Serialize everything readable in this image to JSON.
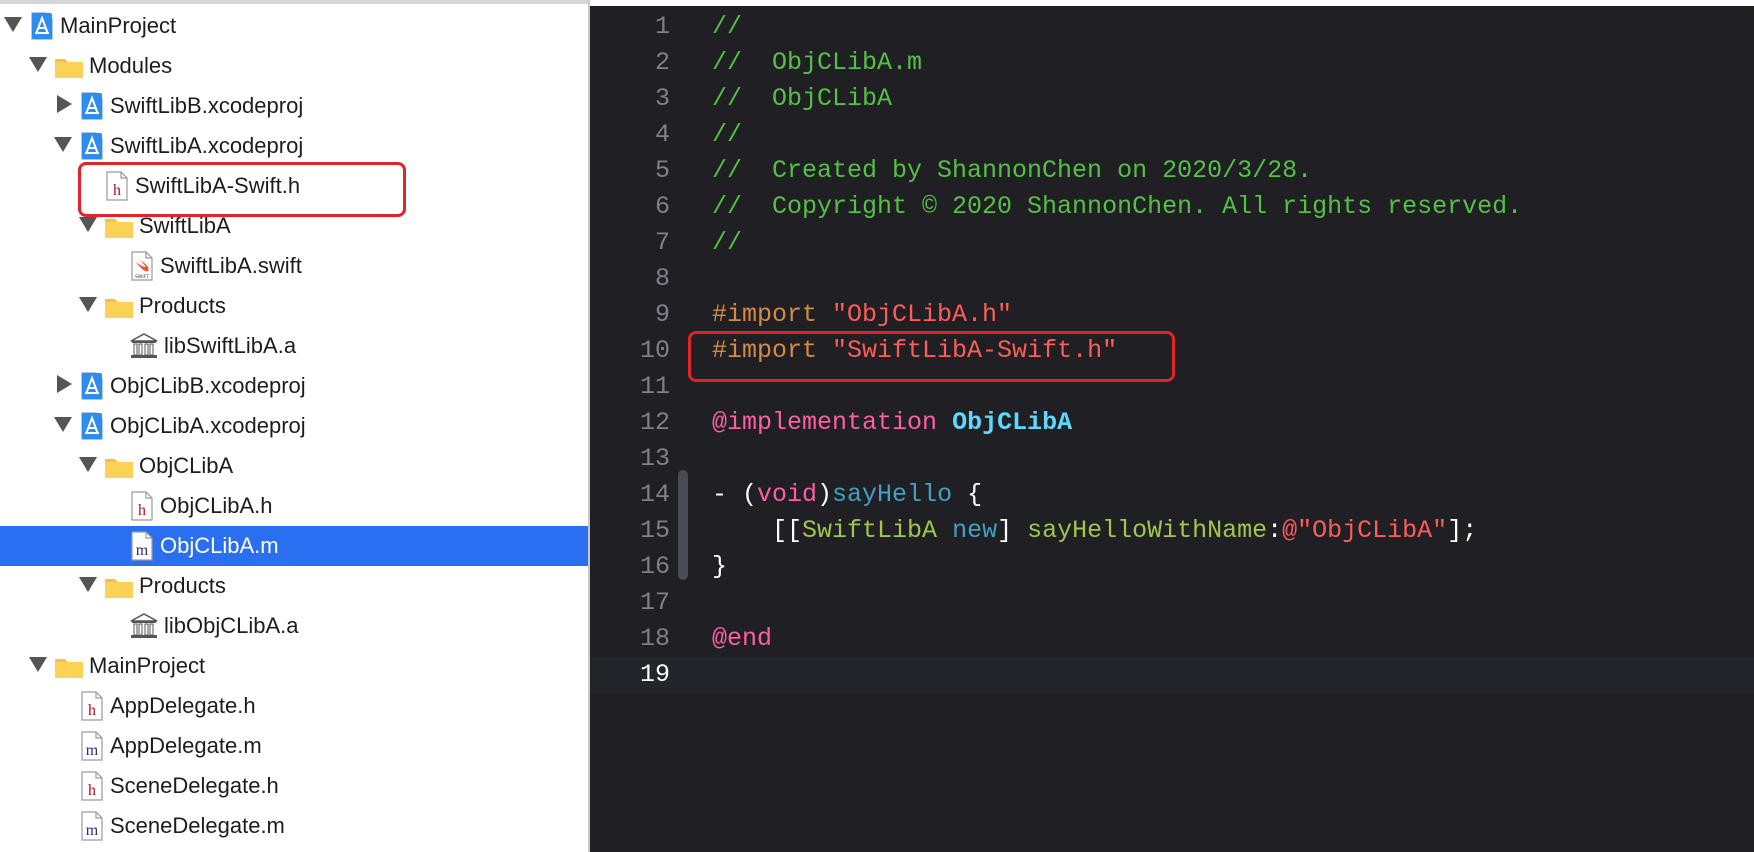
{
  "navigator": {
    "items": [
      {
        "label": "MainProject",
        "icon": "xcodeproj-icon",
        "disclosure": "down",
        "depth": 0
      },
      {
        "label": "Modules",
        "icon": "folder-icon",
        "disclosure": "down",
        "depth": 1
      },
      {
        "label": "SwiftLibB.xcodeproj",
        "icon": "xcodeproj-icon",
        "disclosure": "right",
        "depth": 2
      },
      {
        "label": "SwiftLibA.xcodeproj",
        "icon": "xcodeproj-icon",
        "disclosure": "down",
        "depth": 2
      },
      {
        "label": "SwiftLibA-Swift.h",
        "icon": "header-file-icon",
        "disclosure": "none",
        "depth": 3,
        "highlighted": true
      },
      {
        "label": "SwiftLibA",
        "icon": "folder-icon",
        "disclosure": "down",
        "depth": 3
      },
      {
        "label": "SwiftLibA.swift",
        "icon": "swift-file-icon",
        "disclosure": "none",
        "depth": 4
      },
      {
        "label": "Products",
        "icon": "folder-icon",
        "disclosure": "down",
        "depth": 3
      },
      {
        "label": "libSwiftLibA.a",
        "icon": "library-icon",
        "disclosure": "none",
        "depth": 4
      },
      {
        "label": "ObjCLibB.xcodeproj",
        "icon": "xcodeproj-icon",
        "disclosure": "right",
        "depth": 2
      },
      {
        "label": "ObjCLibA.xcodeproj",
        "icon": "xcodeproj-icon",
        "disclosure": "down",
        "depth": 2
      },
      {
        "label": "ObjCLibA",
        "icon": "folder-icon",
        "disclosure": "down",
        "depth": 3
      },
      {
        "label": "ObjCLibA.h",
        "icon": "header-file-icon",
        "disclosure": "none",
        "depth": 4
      },
      {
        "label": "ObjCLibA.m",
        "icon": "implementation-file-icon",
        "disclosure": "none",
        "depth": 4,
        "selected": true
      },
      {
        "label": "Products",
        "icon": "folder-icon",
        "disclosure": "down",
        "depth": 3
      },
      {
        "label": "libObjCLibA.a",
        "icon": "library-icon",
        "disclosure": "none",
        "depth": 4
      },
      {
        "label": "MainProject",
        "icon": "folder-icon",
        "disclosure": "down",
        "depth": 1
      },
      {
        "label": "AppDelegate.h",
        "icon": "header-file-icon",
        "disclosure": "none",
        "depth": 2
      },
      {
        "label": "AppDelegate.m",
        "icon": "implementation-file-icon",
        "disclosure": "none",
        "depth": 2
      },
      {
        "label": "SceneDelegate.h",
        "icon": "header-file-icon",
        "disclosure": "none",
        "depth": 2
      },
      {
        "label": "SceneDelegate.m",
        "icon": "implementation-file-icon",
        "disclosure": "none",
        "depth": 2
      }
    ]
  },
  "editor": {
    "current_line": 19,
    "highlighted_line": 10,
    "lines": [
      {
        "n": "1",
        "tokens": [
          {
            "t": "//",
            "c": "cm"
          }
        ]
      },
      {
        "n": "2",
        "tokens": [
          {
            "t": "//  ObjCLibA.m",
            "c": "cm"
          }
        ]
      },
      {
        "n": "3",
        "tokens": [
          {
            "t": "//  ObjCLibA",
            "c": "cm"
          }
        ]
      },
      {
        "n": "4",
        "tokens": [
          {
            "t": "//",
            "c": "cm"
          }
        ]
      },
      {
        "n": "5",
        "tokens": [
          {
            "t": "//  Created by ShannonChen on 2020/3/28.",
            "c": "cm"
          }
        ]
      },
      {
        "n": "6",
        "tokens": [
          {
            "t": "//  Copyright © 2020 ShannonChen. All rights reserved.",
            "c": "cm"
          }
        ]
      },
      {
        "n": "7",
        "tokens": [
          {
            "t": "//",
            "c": "cm"
          }
        ]
      },
      {
        "n": "8",
        "tokens": []
      },
      {
        "n": "9",
        "tokens": [
          {
            "t": "#import ",
            "c": "pp"
          },
          {
            "t": "\"ObjCLibA.h\"",
            "c": "str"
          }
        ]
      },
      {
        "n": "10",
        "tokens": [
          {
            "t": "#import ",
            "c": "pp"
          },
          {
            "t": "\"SwiftLibA-Swift.h\"",
            "c": "str"
          }
        ]
      },
      {
        "n": "11",
        "tokens": []
      },
      {
        "n": "12",
        "tokens": [
          {
            "t": "@implementation",
            "c": "kw"
          },
          {
            "t": " ",
            "c": ""
          },
          {
            "t": "ObjCLibA",
            "c": "cls"
          }
        ]
      },
      {
        "n": "13",
        "tokens": []
      },
      {
        "n": "14",
        "tokens": [
          {
            "t": "- (",
            "c": ""
          },
          {
            "t": "void",
            "c": "kw"
          },
          {
            "t": ")",
            "c": ""
          },
          {
            "t": "sayHello",
            "c": "fn"
          },
          {
            "t": " {",
            "c": ""
          }
        ]
      },
      {
        "n": "15",
        "tokens": [
          {
            "t": "    [[",
            "c": ""
          },
          {
            "t": "SwiftLibA",
            "c": "mth"
          },
          {
            "t": " ",
            "c": ""
          },
          {
            "t": "new",
            "c": "fn"
          },
          {
            "t": "] ",
            "c": ""
          },
          {
            "t": "sayHelloWithName",
            "c": "mth"
          },
          {
            "t": ":",
            "c": ""
          },
          {
            "t": "@\"ObjCLibA\"",
            "c": "str"
          },
          {
            "t": "];",
            "c": ""
          }
        ]
      },
      {
        "n": "16",
        "tokens": [
          {
            "t": "}",
            "c": ""
          }
        ]
      },
      {
        "n": "17",
        "tokens": []
      },
      {
        "n": "18",
        "tokens": [
          {
            "t": "@end",
            "c": "kw"
          }
        ]
      },
      {
        "n": "19",
        "tokens": []
      }
    ]
  },
  "colors": {
    "selection": "#2a6ff0",
    "annotation_box": "#e0242a",
    "editor_bg": "#1f1f24",
    "comment": "#54c145",
    "string": "#fc5d58",
    "keyword": "#fc5fa3"
  }
}
